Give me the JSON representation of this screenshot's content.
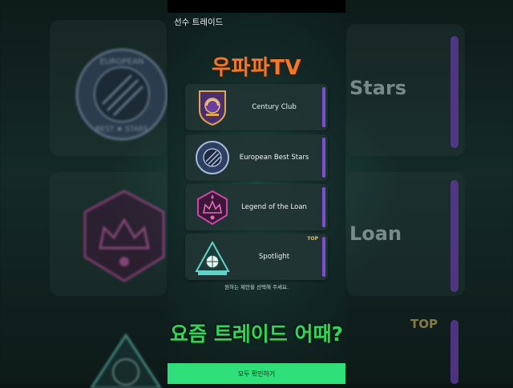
{
  "header": {
    "title": "선수 트레이드"
  },
  "brand": {
    "name": "우파파TV"
  },
  "cards": [
    {
      "name": "Century Club",
      "icon": "century-club-badge-icon",
      "tag": ""
    },
    {
      "name": "European Best Stars",
      "icon": "european-best-stars-badge-icon",
      "tag": ""
    },
    {
      "name": "Legend of the Loan",
      "icon": "legend-of-the-loan-badge-icon",
      "tag": ""
    },
    {
      "name": "Spotlight",
      "icon": "spotlight-badge-icon",
      "tag": "TOP"
    }
  ],
  "hint": "원하는 제안을 선택해 주세요.",
  "question": "요즘 트레이드 어때?",
  "confirm_button": "모두 확인하기",
  "background": {
    "stars_text": "Stars",
    "loan_text": "Loan",
    "top_text": "TOP",
    "badge_text_top": "EUROPEAN",
    "badge_text_bottom": "BEST ★ STARS"
  },
  "colors": {
    "accent_purple": "#7d4fd0",
    "brand_orange": "#f07a2a",
    "question_green": "#34d45a",
    "confirm_green": "#2fe07a"
  }
}
